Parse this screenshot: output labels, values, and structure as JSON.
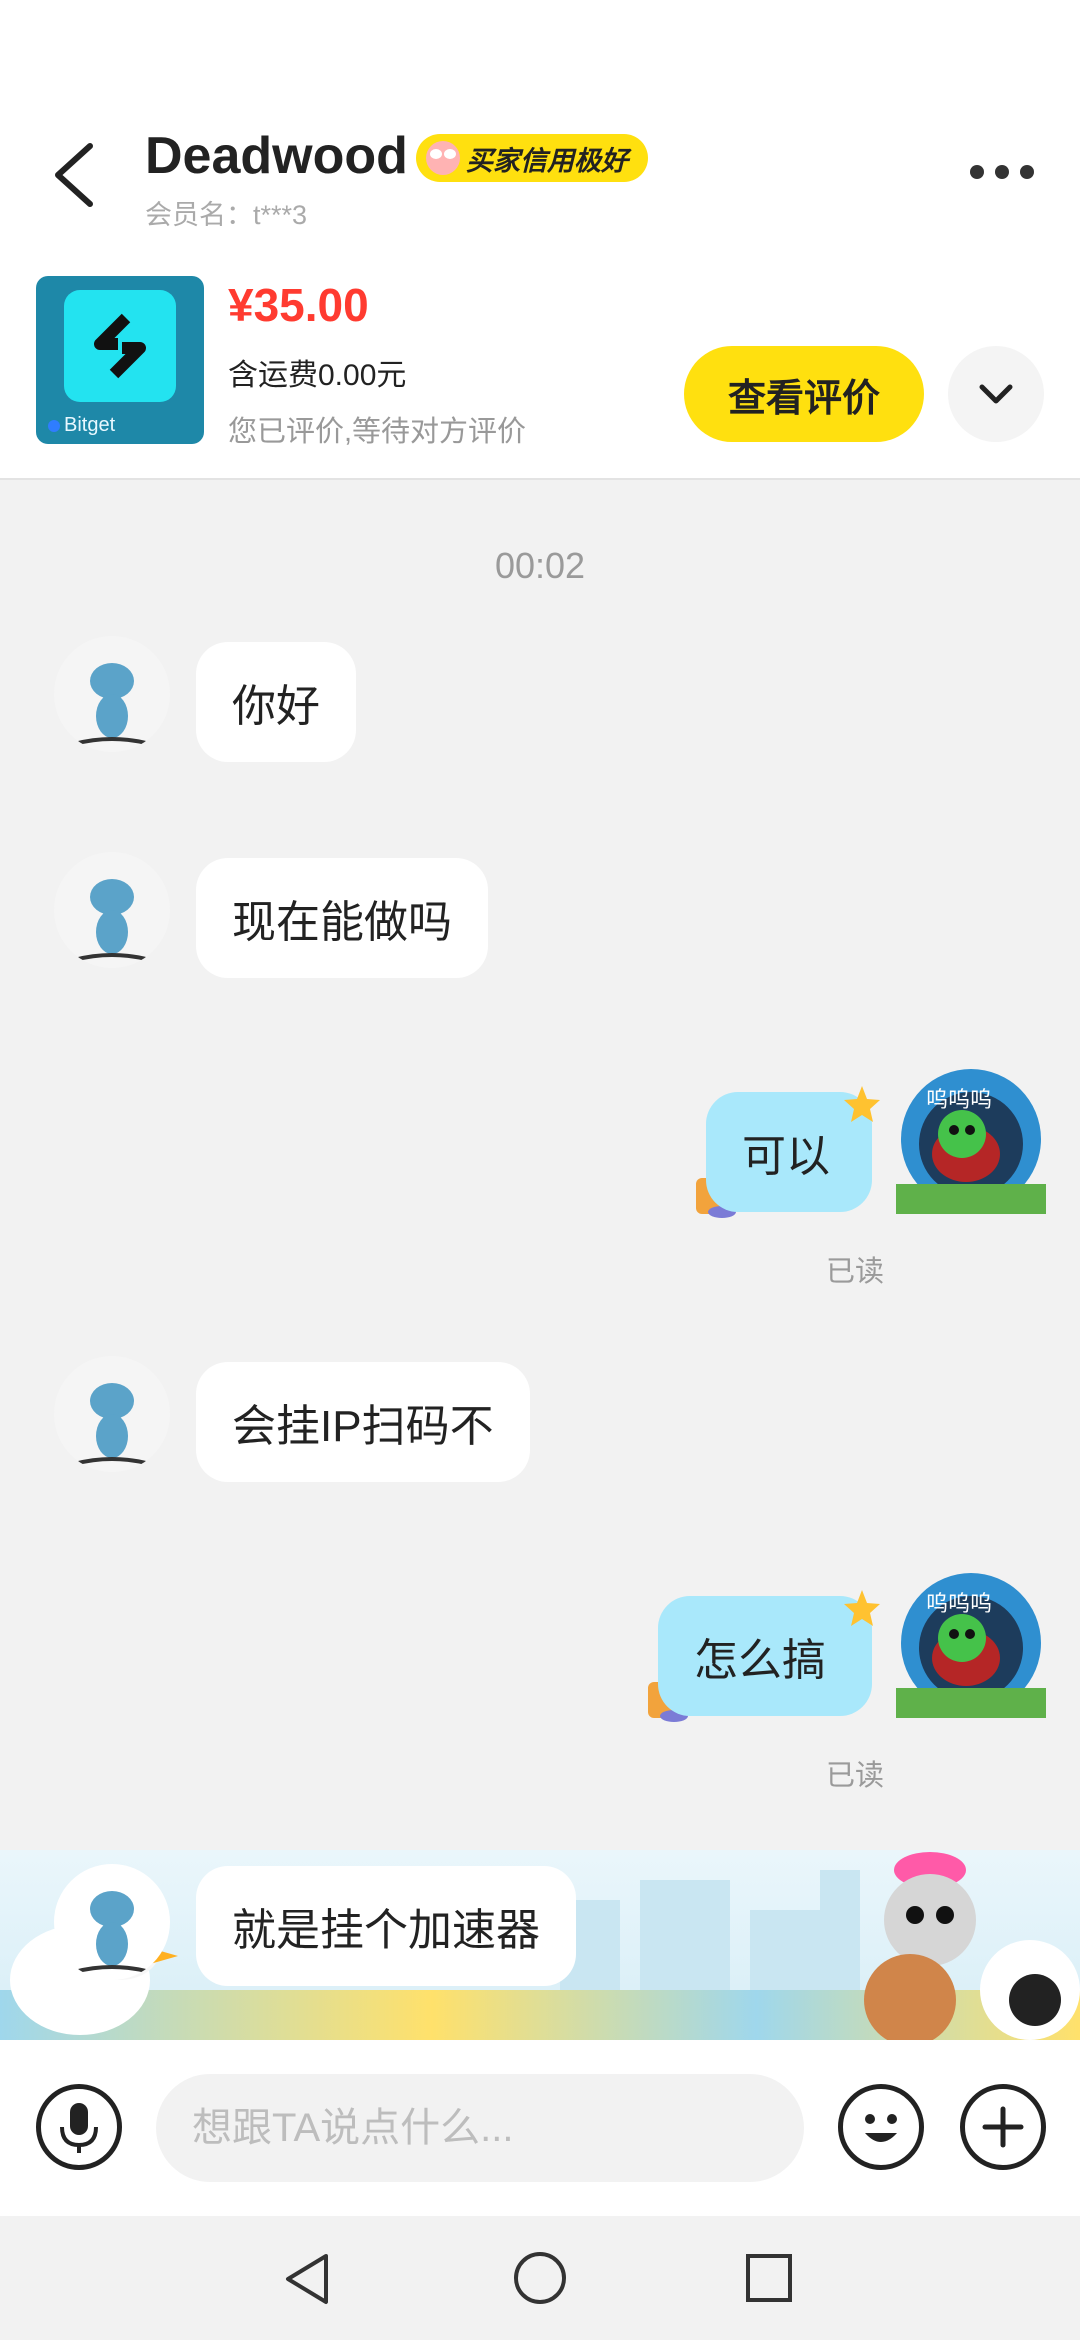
{
  "header": {
    "title": "Deadwood",
    "badge": "买家信用极好",
    "member": "会员名：t***3"
  },
  "product": {
    "image_label": "Bitget",
    "price": "¥35.00",
    "shipping": "含运费0.00元",
    "status": "您已评价,等待对方评价",
    "review_button": "查看评价"
  },
  "chat": {
    "time": "00:02",
    "messages": [
      {
        "side": "left",
        "text": "你好"
      },
      {
        "side": "left",
        "text": "现在能做吗"
      },
      {
        "side": "right",
        "text": "可以",
        "status": "已读"
      },
      {
        "side": "left",
        "text": "会挂IP扫码不"
      },
      {
        "side": "right",
        "text": "怎么搞",
        "status": "已读"
      },
      {
        "side": "left",
        "text": "就是挂个加速器"
      }
    ],
    "my_avatar_text": "呜呜呜"
  },
  "input": {
    "placeholder": "想跟TA说点什么..."
  },
  "colors": {
    "accent_yellow": "#ffe00f",
    "price_red": "#ff3b30",
    "my_bubble": "#a9e8fb"
  },
  "icons": [
    "back-arrow-icon",
    "more-dots-icon",
    "chevron-down-icon",
    "microphone-icon",
    "emoji-icon",
    "plus-icon",
    "nav-back-icon",
    "nav-home-icon",
    "nav-recents-icon"
  ]
}
